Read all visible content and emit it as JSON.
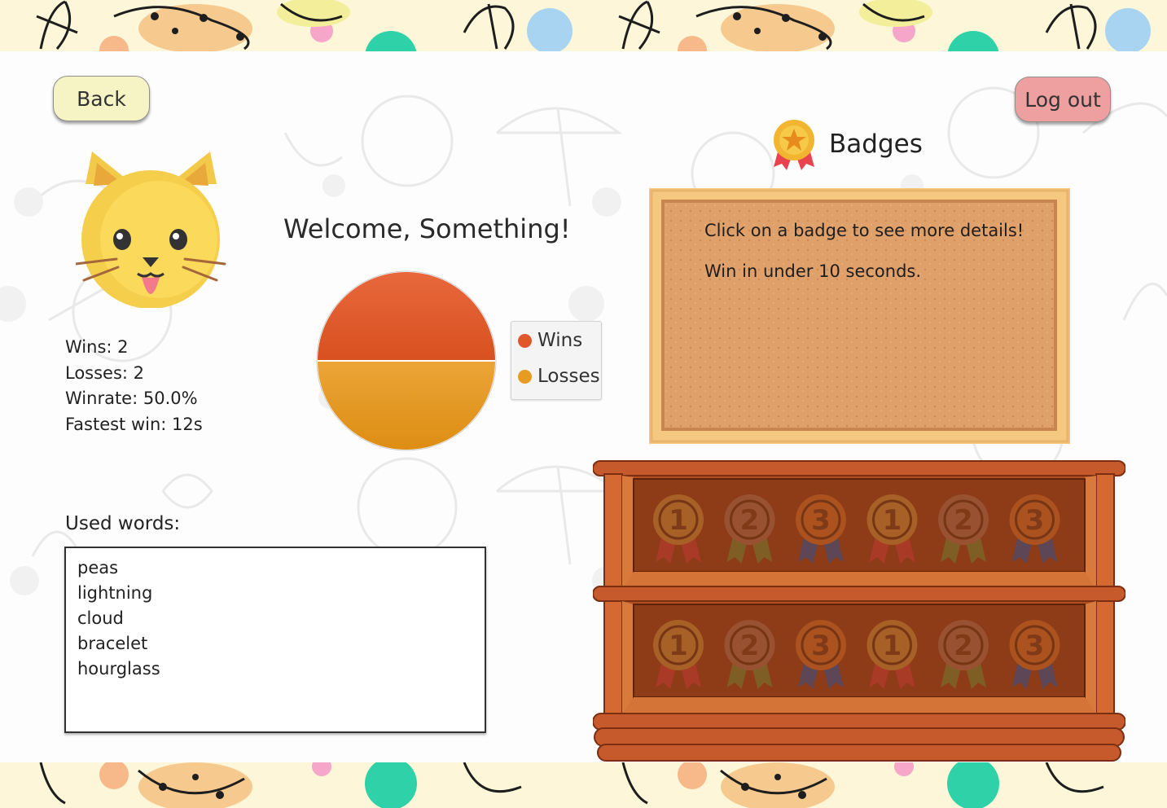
{
  "header": {
    "back_label": "Back",
    "logout_label": "Log out"
  },
  "profile": {
    "avatar_icon": "cat-face-icon",
    "welcome_text": "Welcome, Something!",
    "stats": {
      "wins": "Wins: 2",
      "losses": "Losses: 2",
      "winrate": "Winrate: 50.0%",
      "fastest_win": "Fastest win: 12s"
    }
  },
  "chart_data": {
    "type": "pie",
    "categories": [
      "Wins",
      "Losses"
    ],
    "values": [
      2,
      2
    ],
    "colors": [
      "#e0572b",
      "#e89b22"
    ],
    "legend_placement": "right"
  },
  "used_words": {
    "label": "Used words:",
    "words": [
      "peas",
      "lightning",
      "cloud",
      "bracelet",
      "hourglass"
    ]
  },
  "badges": {
    "title": "Badges",
    "title_icon": "medal-icon",
    "board_hint": "Click on a badge to see more details!",
    "board_detail": "Win in under 10 seconds.",
    "shelf_rows": [
      [
        "1",
        "2",
        "3",
        "1",
        "2",
        "3"
      ],
      [
        "1",
        "2",
        "3",
        "1",
        "2",
        "3"
      ]
    ]
  }
}
